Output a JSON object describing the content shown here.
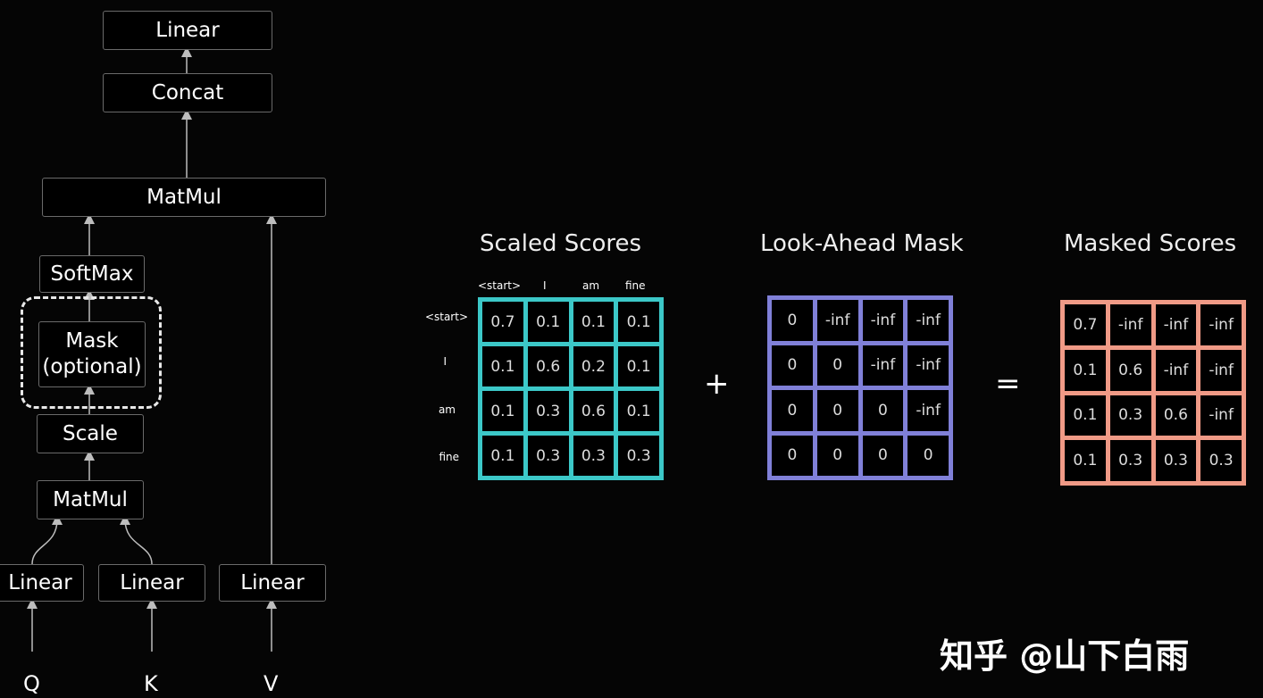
{
  "diagram": {
    "nodes": {
      "linear_top": "Linear",
      "concat": "Concat",
      "matmul_top": "MatMul",
      "softmax": "SoftMax",
      "mask": "Mask\n(optional)",
      "scale": "Scale",
      "matmul_bottom": "MatMul",
      "linear_q": "Linear",
      "linear_k": "Linear",
      "linear_v": "Linear"
    },
    "inputs": {
      "q": "Q",
      "k": "K",
      "v": "V"
    }
  },
  "matrices": {
    "col_labels": [
      "<start>",
      "I",
      "am",
      "fine"
    ],
    "row_labels": [
      "<start>",
      "I",
      "am",
      "fine"
    ],
    "scaled": {
      "title": "Scaled Scores",
      "color": "#3cc8c8",
      "rows": [
        [
          "0.7",
          "0.1",
          "0.1",
          "0.1"
        ],
        [
          "0.1",
          "0.6",
          "0.2",
          "0.1"
        ],
        [
          "0.1",
          "0.3",
          "0.6",
          "0.1"
        ],
        [
          "0.1",
          "0.3",
          "0.3",
          "0.3"
        ]
      ]
    },
    "mask": {
      "title": "Look-Ahead Mask",
      "color": "#8080d8",
      "rows": [
        [
          "0",
          "-inf",
          "-inf",
          "-inf"
        ],
        [
          "0",
          "0",
          "-inf",
          "-inf"
        ],
        [
          "0",
          "0",
          "0",
          "-inf"
        ],
        [
          "0",
          "0",
          "0",
          "0"
        ]
      ]
    },
    "masked": {
      "title": "Masked Scores",
      "color": "#f09a86",
      "rows": [
        [
          "0.7",
          "-inf",
          "-inf",
          "-inf"
        ],
        [
          "0.1",
          "0.6",
          "-inf",
          "-inf"
        ],
        [
          "0.1",
          "0.3",
          "0.6",
          "-inf"
        ],
        [
          "0.1",
          "0.3",
          "0.3",
          "0.3"
        ]
      ]
    },
    "plus": "+",
    "equals": "="
  },
  "watermark": "知乎 @山下白雨"
}
